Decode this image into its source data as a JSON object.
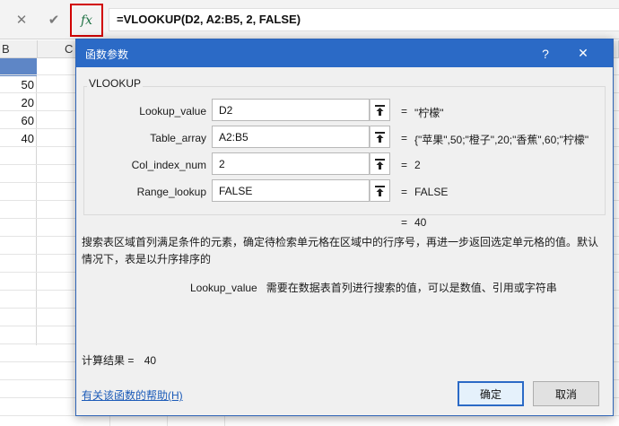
{
  "formula_bar": {
    "cancel_glyph": "✕",
    "confirm_glyph": "✔",
    "fx_label": "fx",
    "formula": "=VLOOKUP(D2, A2:B5, 2, FALSE)"
  },
  "sheet": {
    "column_b": "B",
    "column_c": "C",
    "values": [
      "50",
      "20",
      "60",
      "40"
    ]
  },
  "dialog": {
    "title": "函数参数",
    "help_glyph": "?",
    "close_glyph": "✕",
    "function_name": "VLOOKUP",
    "arguments": [
      {
        "label": "Lookup_value",
        "value": "D2",
        "eq": "=",
        "result": "\"柠檬\""
      },
      {
        "label": "Table_array",
        "value": "A2:B5",
        "eq": "=",
        "result": "{\"苹果\",50;\"橙子\",20;\"香蕉\",60;\"柠檬\""
      },
      {
        "label": "Col_index_num",
        "value": "2",
        "eq": "=",
        "result": "2"
      },
      {
        "label": "Range_lookup",
        "value": "FALSE",
        "eq": "=",
        "result": "FALSE"
      }
    ],
    "formula_result_eq": "=",
    "formula_result": "40",
    "description": "搜索表区域首列满足条件的元素，确定待检索单元格在区域中的行序号，再进一步返回选定单元格的值。默认情况下，表是以升序排序的",
    "param_name": "Lookup_value",
    "param_description": "需要在数据表首列进行搜索的值，可以是数值、引用或字符串",
    "calc_label": "计算结果 =",
    "calc_value": "40",
    "help_link": "有关该函数的帮助(H)",
    "ok_button": "确定",
    "cancel_button": "取消"
  },
  "colors": {
    "title_bar": "#2b6ac6",
    "fx_highlight": "#d10000",
    "link": "#1c5bb8",
    "selected_header": "#5e86c6"
  },
  "icons": {
    "collapse": "collapse-dialog-icon",
    "fx": "function-icon"
  }
}
